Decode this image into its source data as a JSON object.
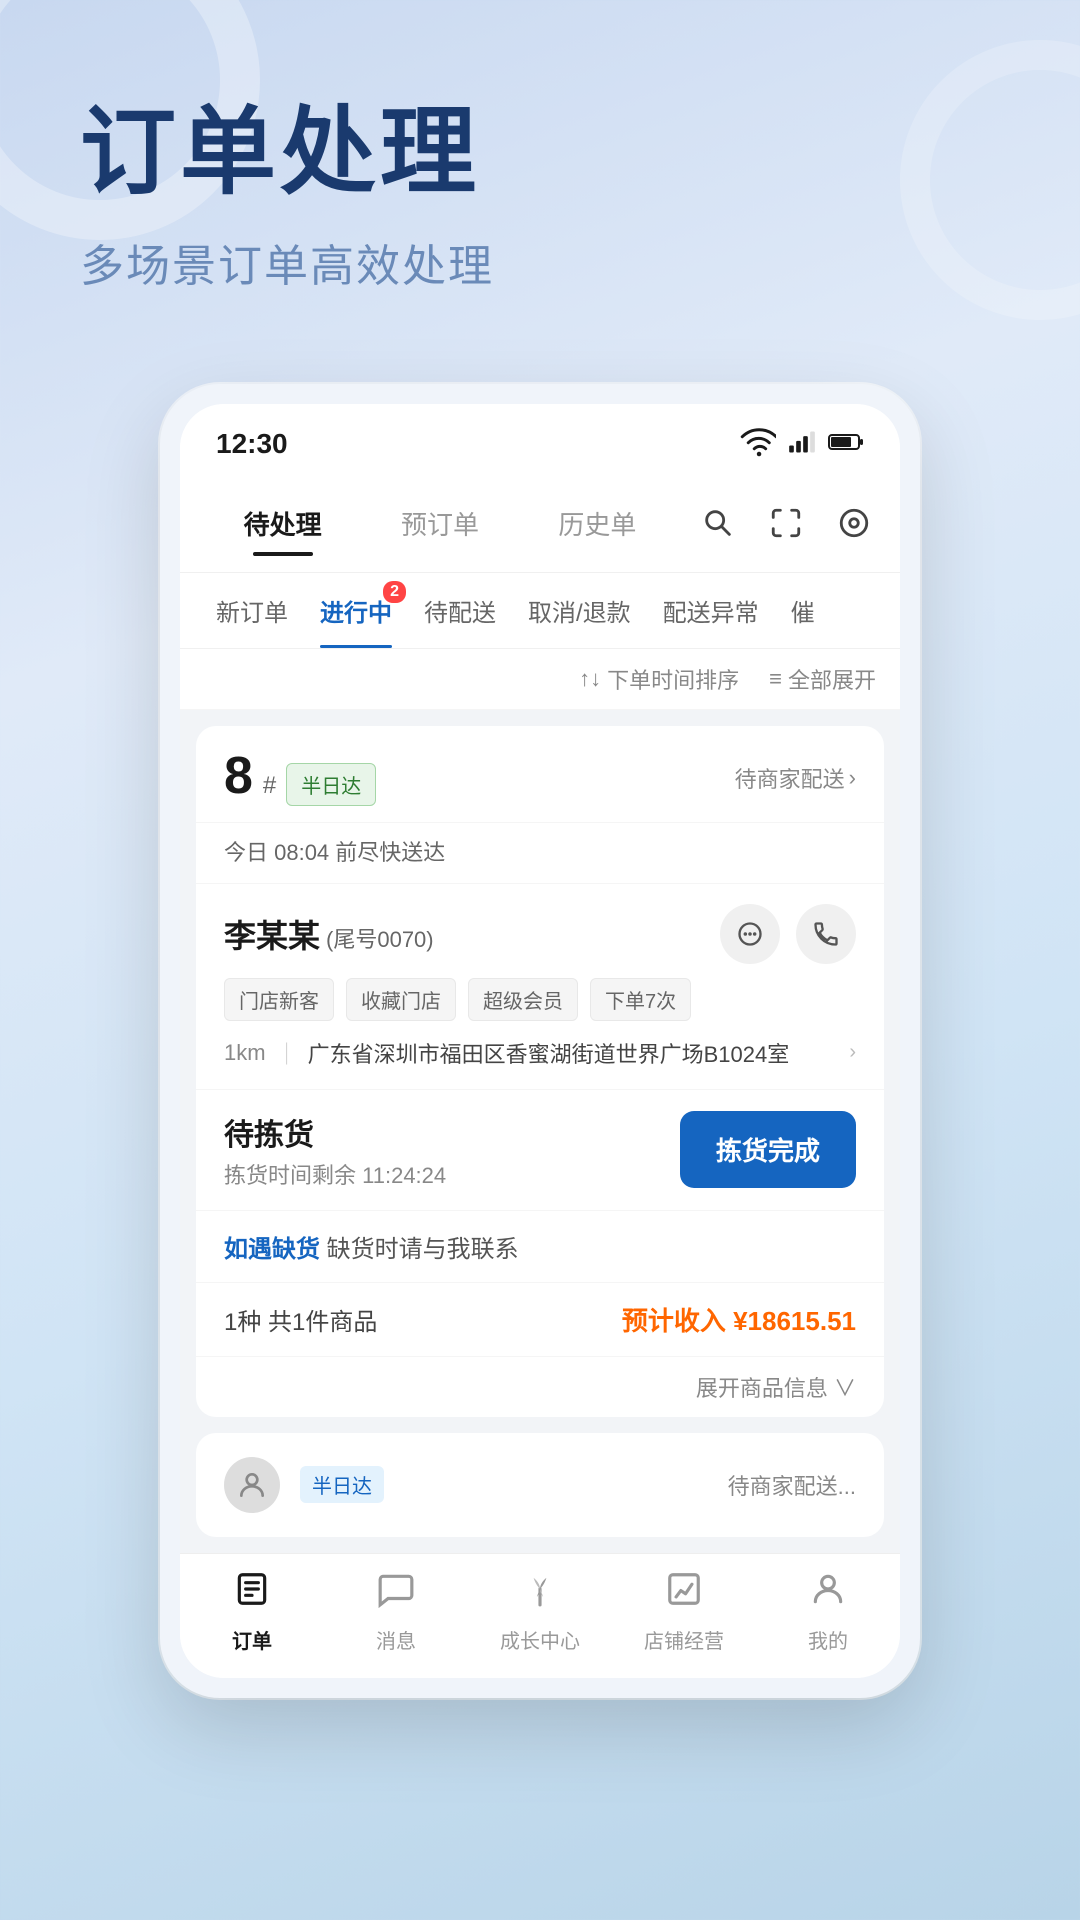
{
  "app": {
    "background_title": "订单处理",
    "background_subtitle": "多场景订单高效处理"
  },
  "status_bar": {
    "time": "12:30",
    "wifi": "📶",
    "signal": "📶",
    "battery": "🔋"
  },
  "top_tabs": [
    {
      "id": "pending",
      "label": "待处理",
      "active": true
    },
    {
      "id": "prebook",
      "label": "预订单",
      "active": false
    },
    {
      "id": "history",
      "label": "历史单",
      "active": false
    }
  ],
  "sub_nav": [
    {
      "id": "new",
      "label": "新订单",
      "active": false,
      "badge": null
    },
    {
      "id": "inprogress",
      "label": "进行中",
      "active": true,
      "badge": "2"
    },
    {
      "id": "pending_delivery",
      "label": "待配送",
      "active": false,
      "badge": null
    },
    {
      "id": "cancel_refund",
      "label": "取消/退款",
      "active": false,
      "badge": null
    },
    {
      "id": "delivery_issue",
      "label": "配送异常",
      "active": false,
      "badge": null
    },
    {
      "id": "remind",
      "label": "催",
      "active": false,
      "badge": null
    }
  ],
  "sort_bar": {
    "sort_label": "↑↓ 下单时间排序",
    "expand_all_label": "≡ 全部展开"
  },
  "order_card": {
    "order_number": "8",
    "order_number_suffix": "#",
    "order_type_tag": "半日达",
    "order_status": "待商家配送",
    "order_time": "今日 08:04 前尽快送达",
    "customer_name": "李某某",
    "customer_id": "(尾号0070)",
    "tags": [
      "门店新客",
      "收藏门店",
      "超级会员",
      "下单7次"
    ],
    "distance": "1km",
    "address": "广东省深圳市福田区香蜜湖街道世界广场B1024室",
    "picking_status": "待拣货",
    "picking_timer_label": "拣货时间剩余",
    "picking_time": "11:24:24",
    "picking_btn_label": "拣货完成",
    "stock_link": "如遇缺货",
    "stock_text": " 缺货时请与我联系",
    "goods_count": "1种 共1件商品",
    "estimated_income_label": "预计收入 ¥",
    "estimated_income": "18615.51",
    "expand_label": "展开商品信息 ∨"
  },
  "bottom_nav": [
    {
      "id": "orders",
      "label": "订单",
      "active": true,
      "icon": "order"
    },
    {
      "id": "messages",
      "label": "消息",
      "active": false,
      "icon": "chat"
    },
    {
      "id": "growth",
      "label": "成长中心",
      "active": false,
      "icon": "sprout"
    },
    {
      "id": "store_ops",
      "label": "店铺经营",
      "active": false,
      "icon": "chart"
    },
    {
      "id": "mine",
      "label": "我的",
      "active": false,
      "icon": "person"
    }
  ]
}
